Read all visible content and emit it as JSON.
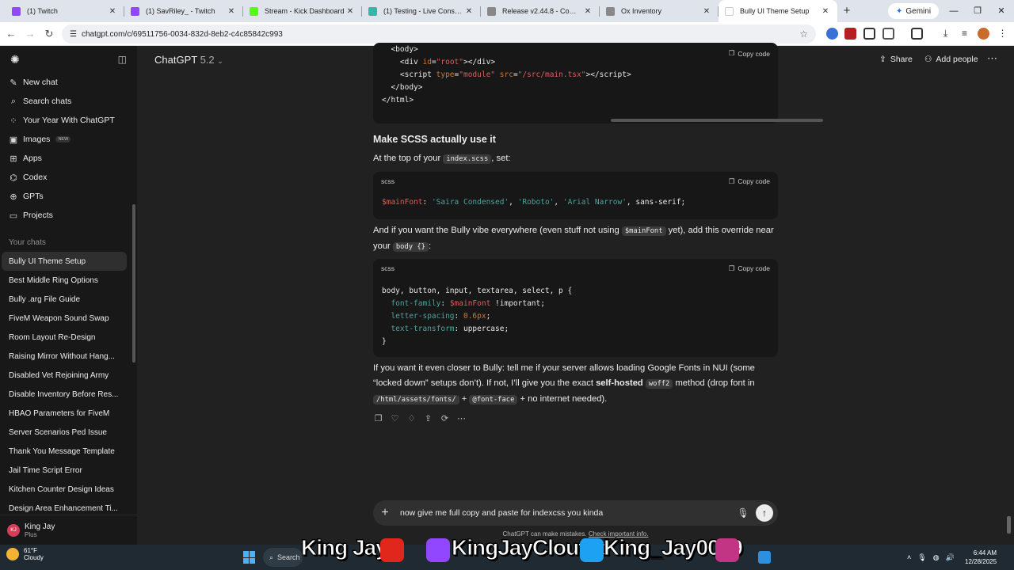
{
  "browser": {
    "tabs": [
      {
        "title": "(1) Twitch",
        "color": "#9146ff"
      },
      {
        "title": "(1) SavRiley_ - Twitch",
        "color": "#9146ff"
      },
      {
        "title": "Stream - Kick Dashboard",
        "color": "#53fc18"
      },
      {
        "title": "(1) Testing - Live Console",
        "color": "#37b6a8"
      },
      {
        "title": "Release v2.44.8 - Community",
        "color": "#888888"
      },
      {
        "title": "Ox Inventory",
        "color": "#888888"
      },
      {
        "title": "Bully UI Theme Setup",
        "color": "#ffffff"
      }
    ],
    "new_tab": "+",
    "gemini": "Gemini",
    "url": "chatgpt.com/c/69511756-0034-832d-8eb2-c4c85842c993"
  },
  "sidebar": {
    "items": [
      {
        "label": "New chat",
        "icon": "✎"
      },
      {
        "label": "Search chats",
        "icon": "⌕"
      },
      {
        "label": "Your Year With ChatGPT",
        "icon": "⁘"
      },
      {
        "label": "Images",
        "icon": "▣",
        "badge": "NEW"
      },
      {
        "label": "Apps",
        "icon": "⊞"
      },
      {
        "label": "Codex",
        "icon": "⌬"
      },
      {
        "label": "GPTs",
        "icon": "⊕"
      },
      {
        "label": "Projects",
        "icon": "▭"
      }
    ],
    "section": "Your chats",
    "chats": [
      "Bully UI Theme Setup",
      "Best Middle Ring Options",
      "Bully .arg File Guide",
      "FiveM Weapon Sound Swap",
      "Room Layout Re-Design",
      "Raising Mirror Without Hang...",
      "Disabled Vet Rejoining Army",
      "Disable Inventory Before Res...",
      "HBAO Parameters for FiveM",
      "Server Scenarios Ped Issue",
      "Thank You Message Template",
      "Jail Time Script Error",
      "Kitchen Counter Design Ideas",
      "Design Area Enhancement Ti..."
    ],
    "user": {
      "initials": "KJ",
      "name": "King Jay",
      "plan": "Plus"
    }
  },
  "header": {
    "model": "ChatGPT",
    "version": "5.2",
    "share": "Share",
    "add_people": "Add people",
    "more": "⋯"
  },
  "content": {
    "copy_label": "Copy code",
    "heading": "Make SCSS actually use it",
    "p1_a": "At the top of your",
    "p1_code": "index.scss",
    "p1_b": ", set:",
    "lang1": "scss",
    "lang2": "scss",
    "p2_a": "And if you want the Bully vibe everywhere (even stuff not using",
    "p2_code": "$mainFont",
    "p2_b": "yet), add this override near your",
    "p2_code2": "body {}",
    "p2_c": ":",
    "p3": "If you want it even closer to Bully: tell me if your server allows loading Google Fonts in NUI (some “locked down” setups don’t). If not, I’ll give you the exact",
    "p3_bold": "self-hosted",
    "p3_code": "woff2",
    "p3_b": "method (drop font in",
    "p3_code2": "/html/assets/fonts/",
    "p3_c": "+",
    "p3_code3": "@font-face",
    "p3_d": "+ no internet needed)."
  },
  "composer": {
    "value": "now give me full copy and paste for indexcss you kinda",
    "disclaimer_a": "ChatGPT can make mistakes.",
    "disclaimer_b": "Check important info."
  },
  "taskbar": {
    "temp": "61°F",
    "cond": "Cloudy",
    "search": "Search",
    "time": "6:44 AM",
    "date": "12/28/2025"
  },
  "overlay": {
    "name": "King Jay",
    "handle1": "KingJayClouted",
    "handle2": "King_Jay0069"
  }
}
